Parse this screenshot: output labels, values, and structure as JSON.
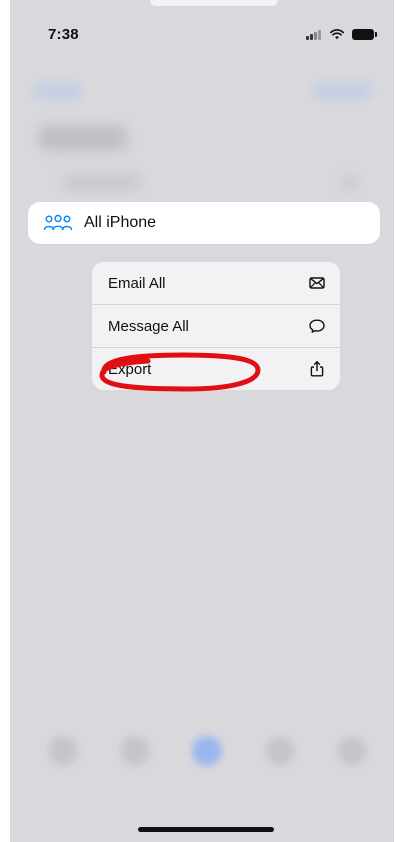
{
  "status_bar": {
    "time": "7:38"
  },
  "context": {
    "group_label": "All iPhone"
  },
  "menu": {
    "items": [
      {
        "label": "Email All",
        "icon": "envelope-icon"
      },
      {
        "label": "Message All",
        "icon": "message-bubble-icon"
      },
      {
        "label": "Export",
        "icon": "share-icon"
      }
    ]
  },
  "colors": {
    "accent_blue": "#0a84ff",
    "annotation_red": "#e10f14",
    "dim_background": "#d9d9dd",
    "menu_bg": "#f2f2f5"
  }
}
